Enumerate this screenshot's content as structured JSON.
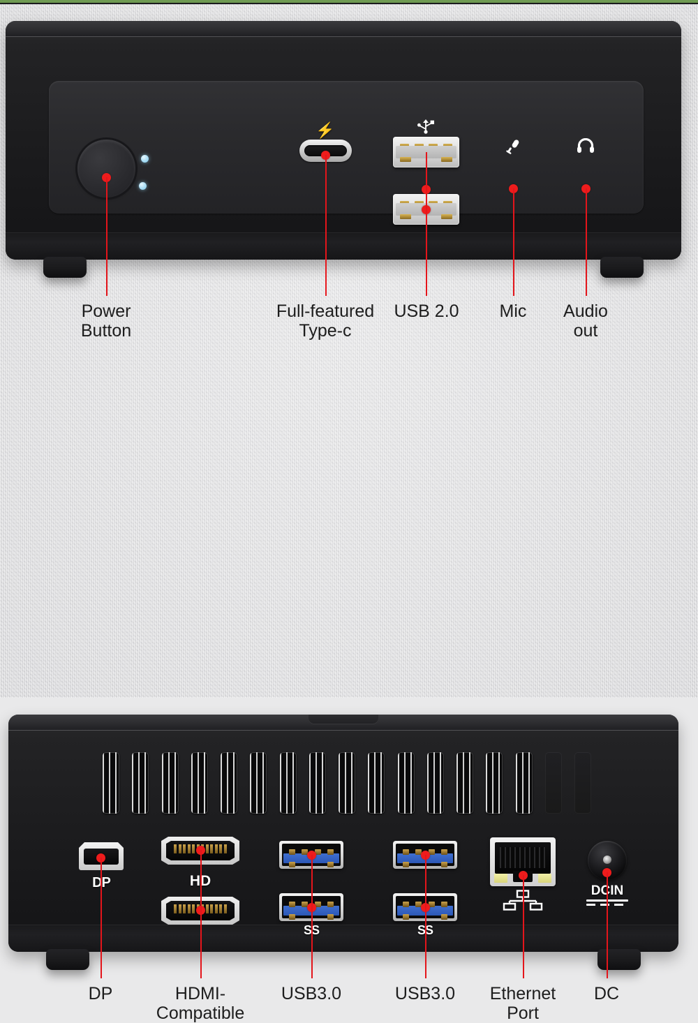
{
  "product": {
    "type": "mini-pc",
    "views": [
      {
        "name": "front-panel",
        "position": "top"
      },
      {
        "name": "rear-panel",
        "position": "bottom"
      }
    ]
  },
  "colors": {
    "callout": "#ee1c1c",
    "chassis": "#1b1b1d",
    "background": "#e6e6e7",
    "usb3_blue": "#2c57b6",
    "audio_green": "#6f9a52",
    "led_blue": "#a8dcf4",
    "ethernet_led": "#e8e49a",
    "label_text": "#1d1d1d"
  },
  "front_panel": {
    "port_markings": {
      "typec_icon": "⚡",
      "usb2_icon": "⎇",
      "mic_icon": "🎤",
      "audio_icon": "🎧"
    },
    "callouts": [
      {
        "id": "power-button",
        "label": "Power\nButton",
        "icon": "power-button-icon"
      },
      {
        "id": "type-c",
        "label": "Full-featured\nType-c",
        "icon": "thunderbolt-icon"
      },
      {
        "id": "usb-2",
        "label": "USB 2.0",
        "icon": "usb-icon"
      },
      {
        "id": "mic",
        "label": "Mic",
        "icon": "microphone-icon"
      },
      {
        "id": "audio-out",
        "label": "Audio\nout",
        "icon": "headphone-icon"
      }
    ]
  },
  "rear_panel": {
    "port_markings": {
      "dp_logo": "DP",
      "hdmi_logo": "HD",
      "usb3_logo": "SS",
      "dc_label": "DCIN"
    },
    "vent_count": 17,
    "callouts": [
      {
        "id": "dp",
        "label": "DP",
        "icon": "displayport-icon"
      },
      {
        "id": "hdmi",
        "label": "HDMI-\nCompatible",
        "icon": "hdmi-icon"
      },
      {
        "id": "usb3-left",
        "label": "USB3.0",
        "icon": "superspeed-usb-icon"
      },
      {
        "id": "usb3-right",
        "label": "USB3.0",
        "icon": "superspeed-usb-icon"
      },
      {
        "id": "ethernet",
        "label": "Ethernet\nPort",
        "icon": "ethernet-icon"
      },
      {
        "id": "dc",
        "label": "DC",
        "icon": "dc-power-icon"
      }
    ]
  }
}
